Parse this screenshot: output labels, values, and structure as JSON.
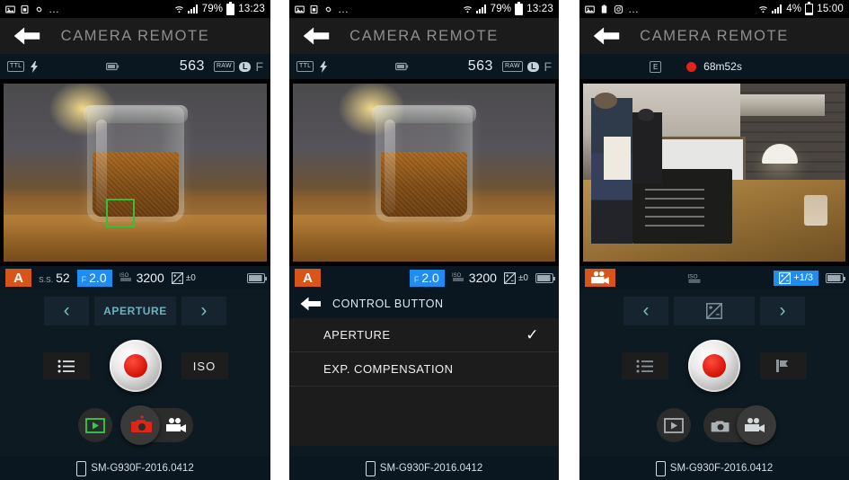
{
  "app": {
    "title": "CAMERA REMOTE",
    "device_label": "SM-G930F-2016.0412",
    "back_icon": "back-arrow-icon",
    "phone_icon": "phone-icon",
    "accent_orange": "#d8551a",
    "accent_blue": "#1f8cf0",
    "accent_teal": "#6fb1bd",
    "accent_red": "#e0241a",
    "bg_dark": "#0d1a22",
    "bar_dark": "#0a1620"
  },
  "panel1": {
    "statusbar": {
      "icons": [
        "image-icon",
        "sim-icon",
        "link-icon"
      ],
      "overflow": "…",
      "wifi_icon": "wifi-icon",
      "signal_icon": "signal-bars-icon",
      "battery_percent": "79%",
      "battery_icon": "battery-icon",
      "time": "13:23"
    },
    "infobar": {
      "flash_mode_icon": "flash-mode-icon",
      "flash_icon": "flash-bolt-icon",
      "camera_battery_icon": "camera-battery-icon",
      "shots_remaining": "563",
      "raw_tag": "RAW",
      "size_tag": "L",
      "quality_tag": "F"
    },
    "preview": {
      "scene": "jar-of-brown-sugar-on-wooden-table",
      "af_box_color": "#34c03a"
    },
    "settings": {
      "mode": "A",
      "ss_label": "S.S.",
      "ss_value": "52",
      "aperture_prefix": "F",
      "aperture_value": "2.0",
      "iso_icon": "iso-icon",
      "iso_value": "3200",
      "ev_icon": "exposure-comp-icon",
      "ev_value": "±0",
      "battery_icon": "camera-battery-icon"
    },
    "nav": {
      "prev": "‹",
      "label": "APERTURE",
      "next": "›"
    },
    "controls": {
      "menu_icon": "list-menu-icon",
      "shutter": "shutter-button",
      "iso_button": "ISO"
    },
    "moderow": {
      "playback_icon": "playback-play-icon",
      "photo_icon": "photo-camera-icon",
      "video_icon": "video-camera-icon",
      "selected": "photo"
    }
  },
  "panel2": {
    "statusbar": {
      "icons": [
        "image-icon",
        "sim-icon",
        "link-icon"
      ],
      "overflow": "…",
      "wifi_icon": "wifi-icon",
      "signal_icon": "signal-bars-icon",
      "battery_percent": "79%",
      "battery_icon": "battery-icon",
      "time": "13:23"
    },
    "infobar": {
      "flash_mode_icon": "flash-mode-icon",
      "flash_icon": "flash-bolt-icon",
      "camera_battery_icon": "camera-battery-icon",
      "shots_remaining": "563",
      "raw_tag": "RAW",
      "size_tag": "L",
      "quality_tag": "F"
    },
    "preview": {
      "scene": "jar-of-brown-sugar-on-wooden-table"
    },
    "settings": {
      "mode": "A",
      "aperture_prefix": "F",
      "aperture_value": "2.0",
      "iso_icon": "iso-icon",
      "iso_value": "3200",
      "ev_icon": "exposure-comp-icon",
      "ev_value": "±0",
      "battery_icon": "camera-battery-icon"
    },
    "menu": {
      "title": "CONTROL BUTTON",
      "back_icon": "back-arrow-icon",
      "items": [
        {
          "label": "APERTURE",
          "checked": true,
          "check_glyph": "✓"
        },
        {
          "label": "EXP. COMPENSATION",
          "checked": false,
          "check_glyph": ""
        }
      ]
    },
    "device_label": "SM-G930F-2016.0412"
  },
  "panel3": {
    "statusbar": {
      "icons": [
        "image-icon",
        "battery-alert-icon",
        "instagram-icon"
      ],
      "overflow": "…",
      "wifi_icon": "wifi-icon",
      "signal_icon": "signal-bars-icon",
      "battery_percent": "4%",
      "battery_icon": "battery-low-icon",
      "time": "15:00"
    },
    "recbar": {
      "quality_tag": "E",
      "rec_dot": "record-dot-icon",
      "time_remaining": "68m52s"
    },
    "preview": {
      "scene": "cafe-interior-with-barista-and-chalkboard-menu"
    },
    "settings": {
      "mode_icon": "video-camera-icon",
      "iso_icon": "iso-icon",
      "ev_icon": "exposure-comp-icon",
      "ev_value": "+1/3",
      "battery_icon": "camera-battery-icon"
    },
    "nav": {
      "prev": "‹",
      "label_icon": "exposure-comp-icon",
      "next": "›"
    },
    "controls": {
      "menu_icon": "list-menu-icon",
      "shutter": "record-button",
      "right_icon": "flag-icon"
    },
    "moderow": {
      "playback_icon": "playback-play-icon",
      "photo_icon": "photo-camera-icon",
      "video_icon": "video-camera-icon",
      "selected": "video"
    },
    "device_label": "SM-G930F-2016.0412"
  }
}
